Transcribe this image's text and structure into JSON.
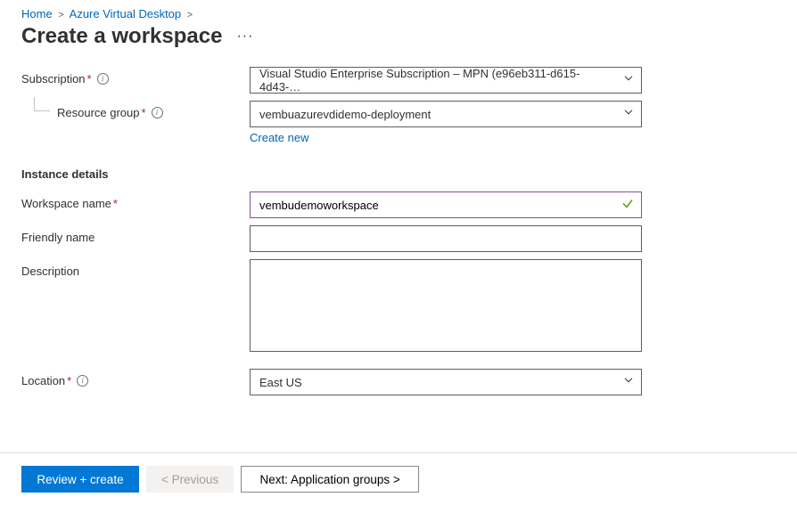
{
  "breadcrumb": {
    "home": "Home",
    "avd": "Azure Virtual Desktop"
  },
  "title": "Create a workspace",
  "more_actions_glyph": "···",
  "labels": {
    "subscription": "Subscription",
    "resource_group": "Resource group",
    "instance_details": "Instance details",
    "workspace_name": "Workspace name",
    "friendly_name": "Friendly name",
    "description": "Description",
    "location": "Location"
  },
  "fields": {
    "subscription": "Visual Studio Enterprise Subscription – MPN (e96eb311-d615-4d43-…",
    "resource_group": "vembuazurevdidemo-deployment",
    "create_new": "Create new",
    "workspace_name": "vembudemoworkspace",
    "friendly_name": "",
    "description": "",
    "location": "East US"
  },
  "footer": {
    "review_create": "Review + create",
    "previous": "< Previous",
    "next": "Next: Application groups >"
  }
}
